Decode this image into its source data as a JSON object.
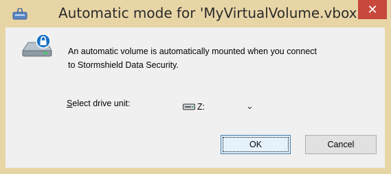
{
  "window": {
    "title": "Automatic mode for 'MyVirtualVolume.vbox'",
    "close_label": "✕"
  },
  "message": {
    "line1": "An automatic volume is automatically mounted when you connect",
    "line2": "to Stormshield Data Security."
  },
  "drive": {
    "label_prefix": "S",
    "label_rest": "elect drive unit:",
    "selected_value": "Z:",
    "arrow": "⌄"
  },
  "buttons": {
    "ok_label": "OK",
    "cancel_label": "Cancel"
  },
  "icons": {
    "app": "virtual-volume-app-icon",
    "drive": "locked-drive-icon",
    "hd": "hard-drive-icon"
  },
  "colors": {
    "titlebar": "#e8d5a6",
    "close": "#c7493b",
    "client": "#f0f0f0"
  }
}
